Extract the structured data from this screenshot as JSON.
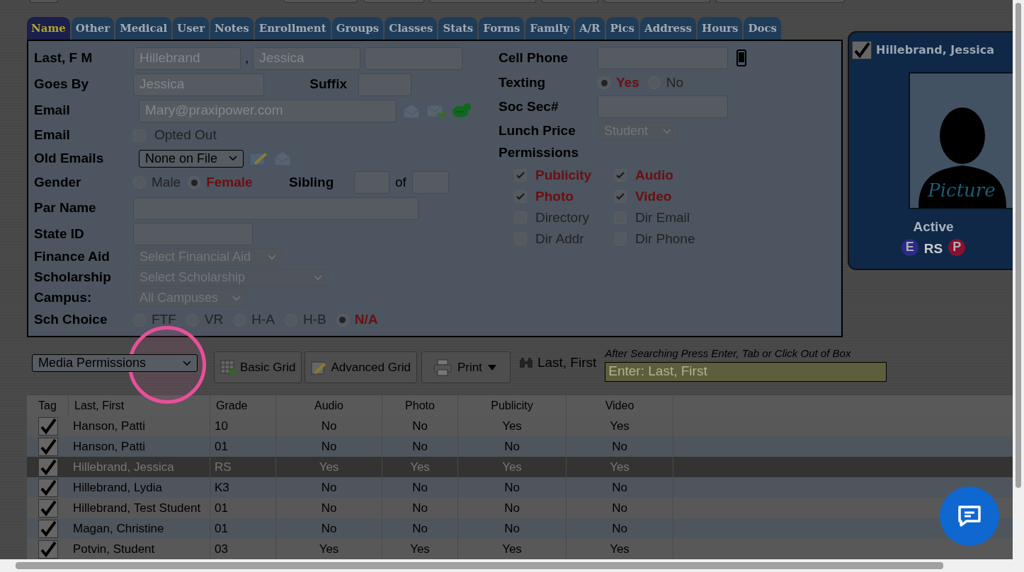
{
  "tabs": [
    {
      "label": "Name",
      "selected": true
    },
    {
      "label": "Other",
      "selected": false
    },
    {
      "label": "Medical",
      "selected": false
    },
    {
      "label": "User",
      "selected": false
    },
    {
      "label": "Notes",
      "selected": false
    },
    {
      "label": "Enrollment",
      "selected": false
    },
    {
      "label": "Groups",
      "selected": false
    },
    {
      "label": "Classes",
      "selected": false
    },
    {
      "label": "Stats",
      "selected": false
    },
    {
      "label": "Forms",
      "selected": false
    },
    {
      "label": "Family",
      "selected": false
    },
    {
      "label": "A/R",
      "selected": false
    },
    {
      "label": "Pics",
      "selected": false
    },
    {
      "label": "Address",
      "selected": false
    },
    {
      "label": "Hours",
      "selected": false
    },
    {
      "label": "Docs",
      "selected": false
    }
  ],
  "form": {
    "name": {
      "label": "Last, F M",
      "last": "Hillebrand",
      "separator": ",",
      "first": "Jessica"
    },
    "goes_by": {
      "label": "Goes By",
      "value": "Jessica",
      "suffix_label": "Suffix"
    },
    "email": {
      "label": "Email",
      "value": "Mary@praxipower.com"
    },
    "email_opt": {
      "label": "Email",
      "checkbox_label": "Opted Out",
      "checked": false
    },
    "old_emails": {
      "label": "Old Emails",
      "value": "None on File"
    },
    "gender": {
      "label": "Gender",
      "options": [
        {
          "label": "Male",
          "selected": false
        },
        {
          "label": "Female",
          "selected": true
        }
      ],
      "sibling_label": "Sibling",
      "of_label": "of"
    },
    "par_name": {
      "label": "Par Name"
    },
    "state_id": {
      "label": "State ID"
    },
    "finance_aid": {
      "label": "Finance Aid",
      "value": "Select Financial Aid"
    },
    "scholarship": {
      "label": "Scholarship",
      "value": "Select Scholarship"
    },
    "campus": {
      "label": "Campus:",
      "value": "All Campuses"
    },
    "sch_choice": {
      "label": "Sch Choice",
      "options": [
        {
          "label": "FTF",
          "selected": false
        },
        {
          "label": "VR",
          "selected": false
        },
        {
          "label": "H-A",
          "selected": false
        },
        {
          "label": "H-B",
          "selected": false
        },
        {
          "label": "N/A",
          "selected": true
        }
      ]
    },
    "cell_phone": {
      "label": "Cell Phone"
    },
    "texting": {
      "label": "Texting",
      "options": [
        {
          "label": "Yes",
          "selected": true
        },
        {
          "label": "No",
          "selected": false
        }
      ]
    },
    "soc_sec": {
      "label": "Soc Sec#"
    },
    "lunch_price": {
      "label": "Lunch Price",
      "value": "Student"
    },
    "permissions": {
      "label": "Permissions",
      "items": [
        {
          "label": "Publicity",
          "checked": true
        },
        {
          "label": "Audio",
          "checked": true
        },
        {
          "label": "Photo",
          "checked": true
        },
        {
          "label": "Video",
          "checked": true
        },
        {
          "label": "Directory",
          "checked": false
        },
        {
          "label": "Dir Email",
          "checked": false
        },
        {
          "label": "Dir Addr",
          "checked": false
        },
        {
          "label": "Dir Phone",
          "checked": false
        }
      ]
    }
  },
  "card": {
    "checked": true,
    "name": "Hillebrand, Jessica",
    "picture_label": "Picture",
    "status": "Active",
    "badges": [
      {
        "label": "E",
        "kind": "round",
        "color": "#2a2a8a"
      },
      {
        "label": "RS",
        "kind": "plain",
        "color": "#cccccc"
      },
      {
        "label": "P",
        "kind": "round",
        "color": "#8a1030"
      }
    ]
  },
  "toolbar": {
    "view": "Media Permissions",
    "buttons": [
      {
        "label": "Basic Grid",
        "kind": "grid"
      },
      {
        "label": "Advanced Grid",
        "kind": "edit"
      }
    ],
    "print": "Print",
    "search_label": "Last, First",
    "search_hint": "After Searching Press Enter, Tab or Click Out of Box",
    "search_placeholder": "Enter: Last, First"
  },
  "table": {
    "tag_column": "Tag",
    "columns": [
      "Last, First",
      "Grade",
      "Audio",
      "Photo",
      "Publicity",
      "Video"
    ],
    "rows": [
      {
        "tagged": true,
        "selected": false,
        "cells": [
          "Hanson, Patti",
          "10",
          "No",
          "No",
          "Yes",
          "Yes"
        ]
      },
      {
        "tagged": true,
        "selected": false,
        "cells": [
          "Hanson, Patti",
          "01",
          "No",
          "No",
          "No",
          "No"
        ]
      },
      {
        "tagged": true,
        "selected": true,
        "cells": [
          "Hillebrand, Jessica",
          "RS",
          "Yes",
          "Yes",
          "Yes",
          "Yes"
        ]
      },
      {
        "tagged": true,
        "selected": false,
        "cells": [
          "Hillebrand, Lydia",
          "K3",
          "No",
          "No",
          "No",
          "No"
        ]
      },
      {
        "tagged": true,
        "selected": false,
        "cells": [
          "Hillebrand, Test Student",
          "01",
          "No",
          "No",
          "No",
          "No"
        ]
      },
      {
        "tagged": true,
        "selected": false,
        "cells": [
          "Magan, Christine",
          "01",
          "No",
          "No",
          "No",
          "No"
        ]
      },
      {
        "tagged": true,
        "selected": false,
        "cells": [
          "Potvin, Student",
          "03",
          "Yes",
          "Yes",
          "Yes",
          "Yes"
        ]
      }
    ]
  }
}
